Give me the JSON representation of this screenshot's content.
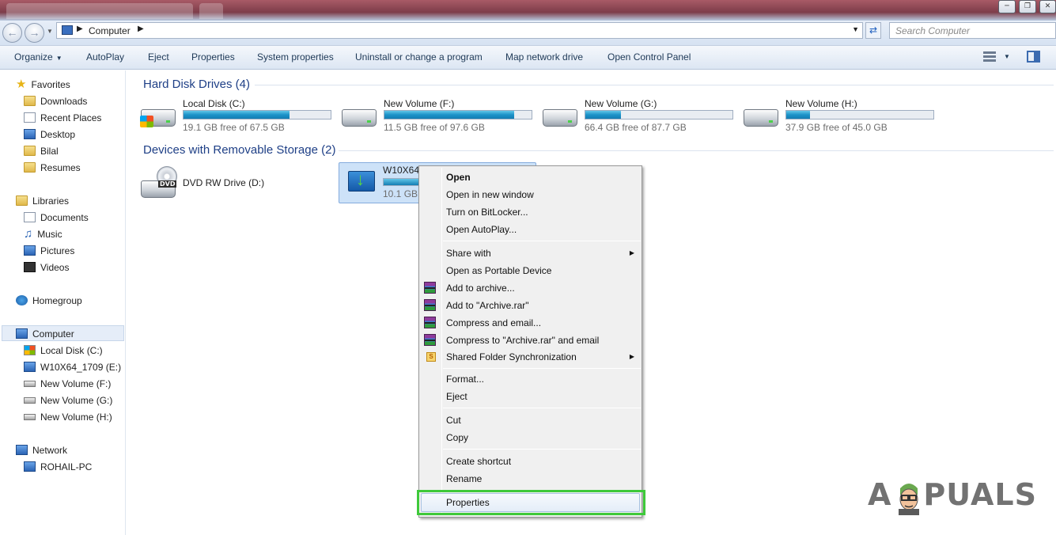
{
  "address": {
    "location": "Computer",
    "search_placeholder": "Search Computer"
  },
  "toolbar": {
    "organize": "Organize",
    "autoplay": "AutoPlay",
    "eject": "Eject",
    "properties": "Properties",
    "system_properties": "System properties",
    "uninstall": "Uninstall or change a program",
    "map_drive": "Map network drive",
    "control_panel": "Open Control Panel"
  },
  "nav": {
    "favorites": "Favorites",
    "downloads": "Downloads",
    "recent_places": "Recent Places",
    "desktop": "Desktop",
    "bilal": "Bilal",
    "resumes": "Resumes",
    "libraries": "Libraries",
    "documents": "Documents",
    "music": "Music",
    "pictures": "Pictures",
    "videos": "Videos",
    "homegroup": "Homegroup",
    "computer": "Computer",
    "local_disk": "Local Disk (C:)",
    "w10x64": "W10X64_1709 (E:)",
    "vol_f": "New Volume (F:)",
    "vol_g": "New Volume (G:)",
    "vol_h": "New Volume (H:)",
    "network": "Network",
    "pc": "ROHAIL-PC"
  },
  "sections": {
    "hard_disks": "Hard Disk Drives (4)",
    "removable": "Devices with Removable Storage (2)"
  },
  "drives": [
    {
      "name": "Local Disk (C:)",
      "free": "19.1 GB free of 67.5 GB",
      "used_fraction": 0.72
    },
    {
      "name": "New Volume (F:)",
      "free": "11.5 GB free of 97.6 GB",
      "used_fraction": 0.88
    },
    {
      "name": "New Volume (G:)",
      "free": "66.4 GB free of 87.7 GB",
      "used_fraction": 0.24
    },
    {
      "name": "New Volume (H:)",
      "free": "37.9 GB free of 45.0 GB",
      "used_fraction": 0.16
    }
  ],
  "removable": {
    "dvd": {
      "name": "DVD RW Drive (D:)",
      "badge": "DVD"
    },
    "usb": {
      "name": "W10X64_",
      "free": "10.1 GB",
      "used_fraction": 0.9
    }
  },
  "context_menu": {
    "open": "Open",
    "open_new_window": "Open in new window",
    "bitlocker": "Turn on BitLocker...",
    "autoplay": "Open AutoPlay...",
    "share_with": "Share with",
    "portable": "Open as Portable Device",
    "add_archive": "Add to archive...",
    "add_rar": "Add to \"Archive.rar\"",
    "compress_email": "Compress and email...",
    "compress_rar_email": "Compress to \"Archive.rar\" and email",
    "shared_sync": "Shared Folder Synchronization",
    "sync_badge": "S",
    "format": "Format...",
    "eject": "Eject",
    "cut": "Cut",
    "copy": "Copy",
    "create_shortcut": "Create shortcut",
    "rename": "Rename",
    "properties": "Properties"
  },
  "watermark": {
    "text_a": "A",
    "text_b": "PUALS"
  },
  "colors": {
    "highlight_box": "#3ec93a",
    "section_title": "#1e3f86",
    "bar_fill": "#1d93c9"
  }
}
